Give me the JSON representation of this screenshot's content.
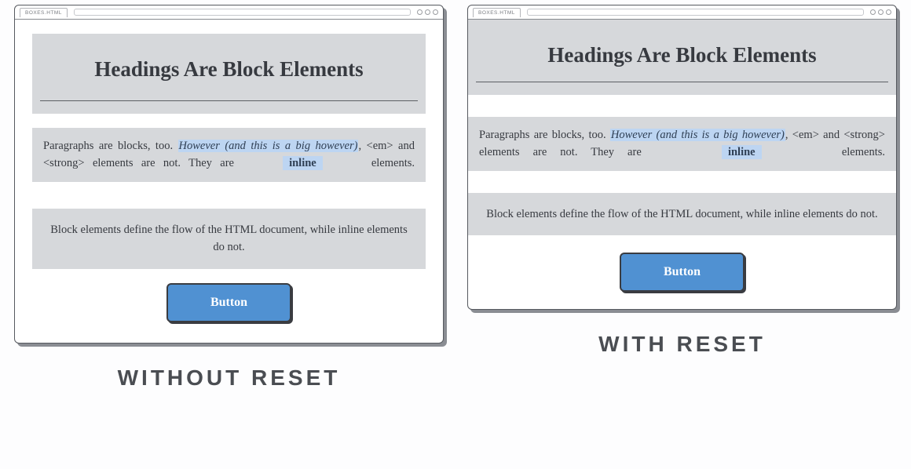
{
  "tab_label": "BOXES.HTML",
  "page": {
    "heading": "Headings Are Block Elements",
    "p1_prefix": "Paragraphs are blocks, too. ",
    "p1_em": "However (and this is a big however)",
    "p1_mid": ", <em> and <strong> elements are not. They are ",
    "p1_strong": "inline",
    "p1_suffix": " elements.",
    "p2": "Block elements define the flow of the HTML document, while inline elements do not.",
    "button": "Button"
  },
  "captions": {
    "left": "WITHOUT RESET",
    "right": "WITH RESET"
  },
  "colors": {
    "block_bg": "#d6d8db",
    "highlight_bg": "#bdd5f2",
    "button_bg": "#5091d2",
    "ink": "#3a3c41"
  }
}
